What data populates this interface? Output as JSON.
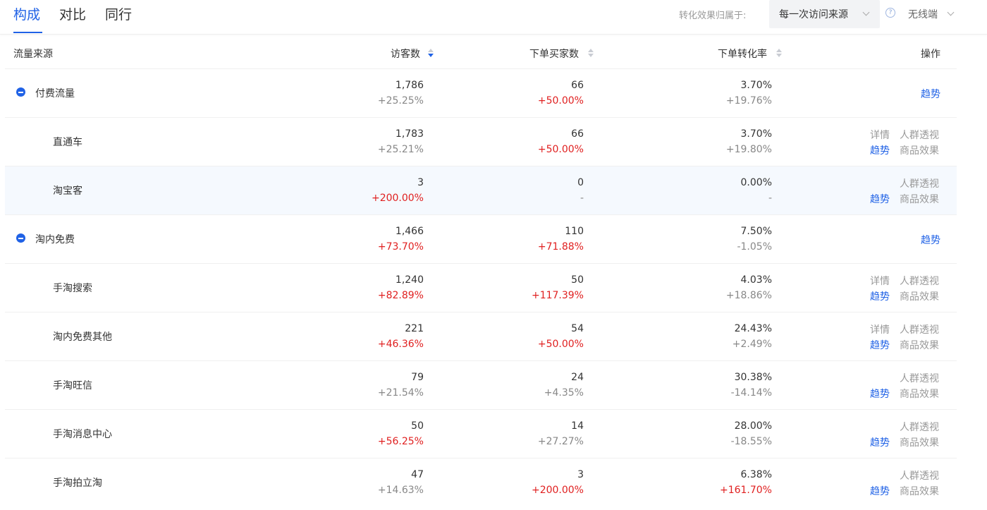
{
  "tabs": [
    "构成",
    "对比",
    "同行"
  ],
  "attribution": {
    "label": "转化效果归属于:",
    "value": "每一次访问来源"
  },
  "device": {
    "value": "无线端"
  },
  "colors": {
    "accent": "#2062e6",
    "increase": "#e02020",
    "neutral": "#888888"
  },
  "headers": {
    "source": "流量来源",
    "visitors": "访客数",
    "buyers": "下单买家数",
    "rate": "下单转化率",
    "ops": "操作"
  },
  "rows": [
    {
      "name": "付费流量",
      "level": 0,
      "visitors": "1,786",
      "visitors_change": "+25.25%",
      "visitors_red": false,
      "buyers": "66",
      "buyers_change": "+50.00%",
      "buyers_red": true,
      "rate": "3.70%",
      "rate_change": "+19.76%",
      "rate_red": false,
      "actions": [
        "趋势"
      ]
    },
    {
      "name": "直通车",
      "level": 1,
      "visitors": "1,783",
      "visitors_change": "+25.21%",
      "visitors_red": false,
      "buyers": "66",
      "buyers_change": "+50.00%",
      "buyers_red": true,
      "rate": "3.70%",
      "rate_change": "+19.80%",
      "rate_red": false,
      "actions": [
        "详情",
        "人群透视",
        "趋势",
        "商品效果"
      ]
    },
    {
      "name": "淘宝客",
      "level": 1,
      "highlight": true,
      "visitors": "3",
      "visitors_change": "+200.00%",
      "visitors_red": true,
      "buyers": "0",
      "buyers_change": "-",
      "buyers_red": false,
      "rate": "0.00%",
      "rate_change": "-",
      "rate_red": false,
      "actions": [
        "人群透视",
        "趋势",
        "商品效果"
      ]
    },
    {
      "name": "淘内免费",
      "level": 0,
      "visitors": "1,466",
      "visitors_change": "+73.70%",
      "visitors_red": true,
      "buyers": "110",
      "buyers_change": "+71.88%",
      "buyers_red": true,
      "rate": "7.50%",
      "rate_change": "-1.05%",
      "rate_red": false,
      "actions": [
        "趋势"
      ]
    },
    {
      "name": "手淘搜索",
      "level": 1,
      "visitors": "1,240",
      "visitors_change": "+82.89%",
      "visitors_red": true,
      "buyers": "50",
      "buyers_change": "+117.39%",
      "buyers_red": true,
      "rate": "4.03%",
      "rate_change": "+18.86%",
      "rate_red": false,
      "actions": [
        "详情",
        "人群透视",
        "趋势",
        "商品效果"
      ]
    },
    {
      "name": "淘内免费其他",
      "level": 1,
      "visitors": "221",
      "visitors_change": "+46.36%",
      "visitors_red": true,
      "buyers": "54",
      "buyers_change": "+50.00%",
      "buyers_red": true,
      "rate": "24.43%",
      "rate_change": "+2.49%",
      "rate_red": false,
      "actions": [
        "详情",
        "人群透视",
        "趋势",
        "商品效果"
      ]
    },
    {
      "name": "手淘旺信",
      "level": 1,
      "visitors": "79",
      "visitors_change": "+21.54%",
      "visitors_red": false,
      "buyers": "24",
      "buyers_change": "+4.35%",
      "buyers_red": false,
      "rate": "30.38%",
      "rate_change": "-14.14%",
      "rate_red": false,
      "actions": [
        "人群透视",
        "趋势",
        "商品效果"
      ]
    },
    {
      "name": "手淘消息中心",
      "level": 1,
      "visitors": "50",
      "visitors_change": "+56.25%",
      "visitors_red": true,
      "buyers": "14",
      "buyers_change": "+27.27%",
      "buyers_red": false,
      "rate": "28.00%",
      "rate_change": "-18.55%",
      "rate_red": false,
      "actions": [
        "人群透视",
        "趋势",
        "商品效果"
      ]
    },
    {
      "name": "手淘拍立淘",
      "level": 1,
      "visitors": "47",
      "visitors_change": "+14.63%",
      "visitors_red": false,
      "buyers": "3",
      "buyers_change": "+200.00%",
      "buyers_red": true,
      "rate": "6.38%",
      "rate_change": "+161.70%",
      "rate_red": true,
      "actions": [
        "人群透视",
        "趋势",
        "商品效果"
      ]
    }
  ]
}
